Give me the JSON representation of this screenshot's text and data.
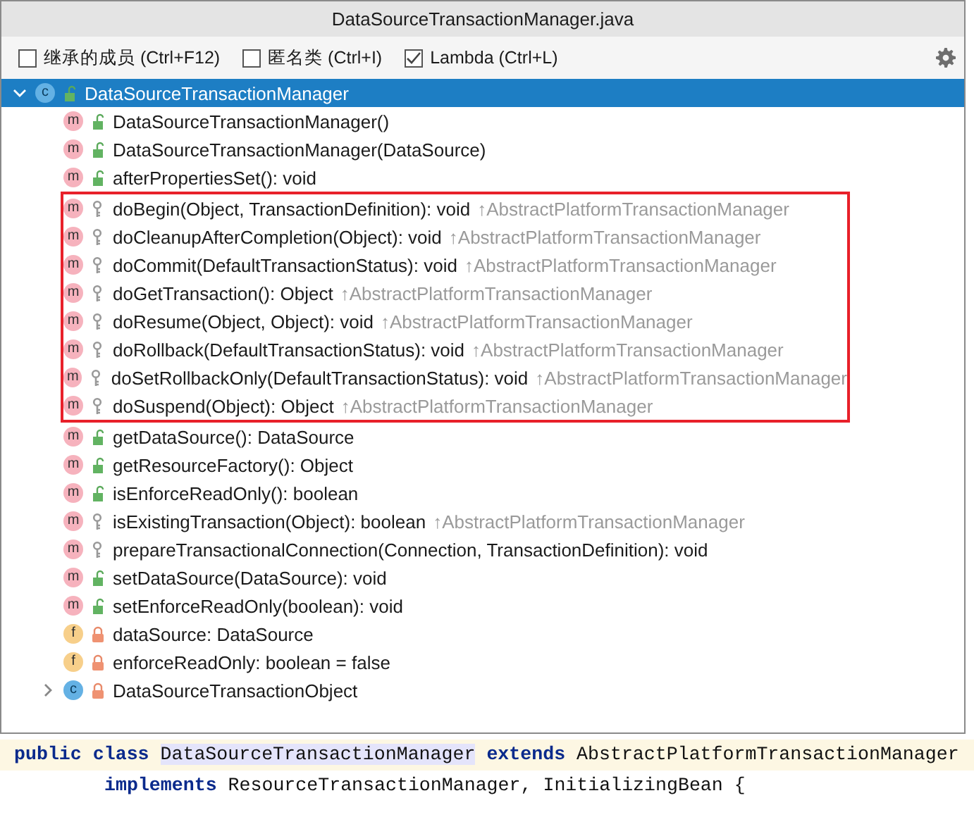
{
  "window": {
    "title": "DataSourceTransactionManager.java"
  },
  "options": [
    {
      "label": "继承的成员 (Ctrl+F12)",
      "checked": false
    },
    {
      "label": "匿名类 (Ctrl+I)",
      "checked": false
    },
    {
      "label": "Lambda (Ctrl+L)",
      "checked": true
    }
  ],
  "tree": [
    {
      "kind": "class",
      "badge": "c",
      "access": {
        "kind": "public"
      },
      "name": "DataSourceTransactionManager",
      "selected": true,
      "expanded": true,
      "children": [
        {
          "kind": "method",
          "badge": "m",
          "access": {
            "kind": "public"
          },
          "name": "DataSourceTransactionManager()",
          "selected": false,
          "highlighted": false
        },
        {
          "kind": "method",
          "badge": "m",
          "access": {
            "kind": "public"
          },
          "name": "DataSourceTransactionManager(DataSource)",
          "selected": false,
          "highlighted": false
        },
        {
          "kind": "method",
          "badge": "m",
          "access": {
            "kind": "public"
          },
          "name": "afterPropertiesSet(): void",
          "selected": false,
          "highlighted": false
        },
        {
          "kind": "method",
          "badge": "m",
          "access": {
            "kind": "protected"
          },
          "name": "doBegin(Object, TransactionDefinition): void",
          "inherited": "↑AbstractPlatformTransactionManager",
          "selected": false,
          "highlighted": true
        },
        {
          "kind": "method",
          "badge": "m",
          "access": {
            "kind": "protected"
          },
          "name": "doCleanupAfterCompletion(Object): void",
          "inherited": "↑AbstractPlatformTransactionManager",
          "selected": false,
          "highlighted": true
        },
        {
          "kind": "method",
          "badge": "m",
          "access": {
            "kind": "protected"
          },
          "name": "doCommit(DefaultTransactionStatus): void",
          "inherited": "↑AbstractPlatformTransactionManager",
          "selected": false,
          "highlighted": true
        },
        {
          "kind": "method",
          "badge": "m",
          "access": {
            "kind": "protected"
          },
          "name": "doGetTransaction(): Object",
          "inherited": "↑AbstractPlatformTransactionManager",
          "selected": false,
          "highlighted": true
        },
        {
          "kind": "method",
          "badge": "m",
          "access": {
            "kind": "protected"
          },
          "name": "doResume(Object, Object): void",
          "inherited": "↑AbstractPlatformTransactionManager",
          "selected": false,
          "highlighted": true
        },
        {
          "kind": "method",
          "badge": "m",
          "access": {
            "kind": "protected"
          },
          "name": "doRollback(DefaultTransactionStatus): void",
          "inherited": "↑AbstractPlatformTransactionManager",
          "selected": false,
          "highlighted": true
        },
        {
          "kind": "method",
          "badge": "m",
          "access": {
            "kind": "protected"
          },
          "name": "doSetRollbackOnly(DefaultTransactionStatus): void",
          "inherited": "↑AbstractPlatformTransactionManager",
          "selected": false,
          "highlighted": true
        },
        {
          "kind": "method",
          "badge": "m",
          "access": {
            "kind": "protected"
          },
          "name": "doSuspend(Object): Object",
          "inherited": "↑AbstractPlatformTransactionManager",
          "selected": false,
          "highlighted": true
        },
        {
          "kind": "method",
          "badge": "m",
          "access": {
            "kind": "public"
          },
          "name": "getDataSource(): DataSource",
          "selected": false,
          "highlighted": false
        },
        {
          "kind": "method",
          "badge": "m",
          "access": {
            "kind": "public"
          },
          "name": "getResourceFactory(): Object",
          "selected": false,
          "highlighted": false
        },
        {
          "kind": "method",
          "badge": "m",
          "access": {
            "kind": "public"
          },
          "name": "isEnforceReadOnly(): boolean",
          "selected": false,
          "highlighted": false
        },
        {
          "kind": "method",
          "badge": "m",
          "access": {
            "kind": "protected"
          },
          "name": "isExistingTransaction(Object): boolean",
          "inherited": "↑AbstractPlatformTransactionManager",
          "selected": false,
          "highlighted": false
        },
        {
          "kind": "method",
          "badge": "m",
          "access": {
            "kind": "protected"
          },
          "name": "prepareTransactionalConnection(Connection, TransactionDefinition): void",
          "selected": false,
          "highlighted": false
        },
        {
          "kind": "method",
          "badge": "m",
          "access": {
            "kind": "public"
          },
          "name": "setDataSource(DataSource): void",
          "selected": false,
          "highlighted": false
        },
        {
          "kind": "method",
          "badge": "m",
          "access": {
            "kind": "public"
          },
          "name": "setEnforceReadOnly(boolean): void",
          "selected": false,
          "highlighted": false
        },
        {
          "kind": "field",
          "badge": "f",
          "access": {
            "kind": "private"
          },
          "name": "dataSource: DataSource",
          "selected": false,
          "highlighted": false
        },
        {
          "kind": "field",
          "badge": "f",
          "access": {
            "kind": "private"
          },
          "name": "enforceReadOnly: boolean = false",
          "selected": false,
          "highlighted": false
        },
        {
          "kind": "class",
          "badge": "c",
          "access": {
            "kind": "private"
          },
          "name": "DataSourceTransactionObject",
          "selected": false,
          "highlighted": false,
          "expanded": false
        }
      ]
    }
  ],
  "code": [
    {
      "current": true,
      "indent": false,
      "tokens": [
        {
          "kind": "keyword",
          "text": "public"
        },
        {
          "kind": "keyword",
          "text": "class"
        },
        {
          "kind": "match",
          "text": "DataSourceTransactionManager"
        },
        {
          "kind": "keyword",
          "text": "extends"
        },
        {
          "kind": "plain",
          "text": "AbstractPlatformTransactionManager"
        }
      ]
    },
    {
      "current": false,
      "indent": true,
      "tokens": [
        {
          "kind": "keyword",
          "text": "implements"
        },
        {
          "kind": "plain",
          "text": "ResourceTransactionManager,"
        },
        {
          "kind": "plain",
          "text": "InitializingBean {"
        }
      ]
    }
  ]
}
